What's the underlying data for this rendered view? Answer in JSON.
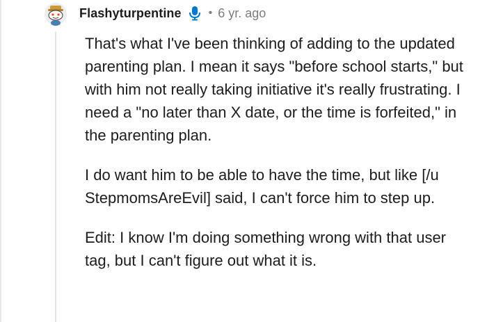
{
  "comment": {
    "author": "Flashyturpentine",
    "separator": "•",
    "age": "6 yr. ago",
    "avatar_icon": "snoo-avatar-icon",
    "badge_icon": "microphone-icon",
    "badge_color": "#0079d3",
    "paragraphs": [
      "That's what I've been thinking of adding to the updated parenting plan. I mean it says \"before school starts,\" but with him not really taking initiative it's really frustrating. I need a \"no later than X date, or the time is forfeited,\" in the parenting plan.",
      "I do want him to be able to have the time, but like [/u StepmomsAreEvil] said, I can't force him to step up.",
      "Edit: I know I'm doing something wrong with that user tag, but I can't figure out what it is."
    ]
  }
}
